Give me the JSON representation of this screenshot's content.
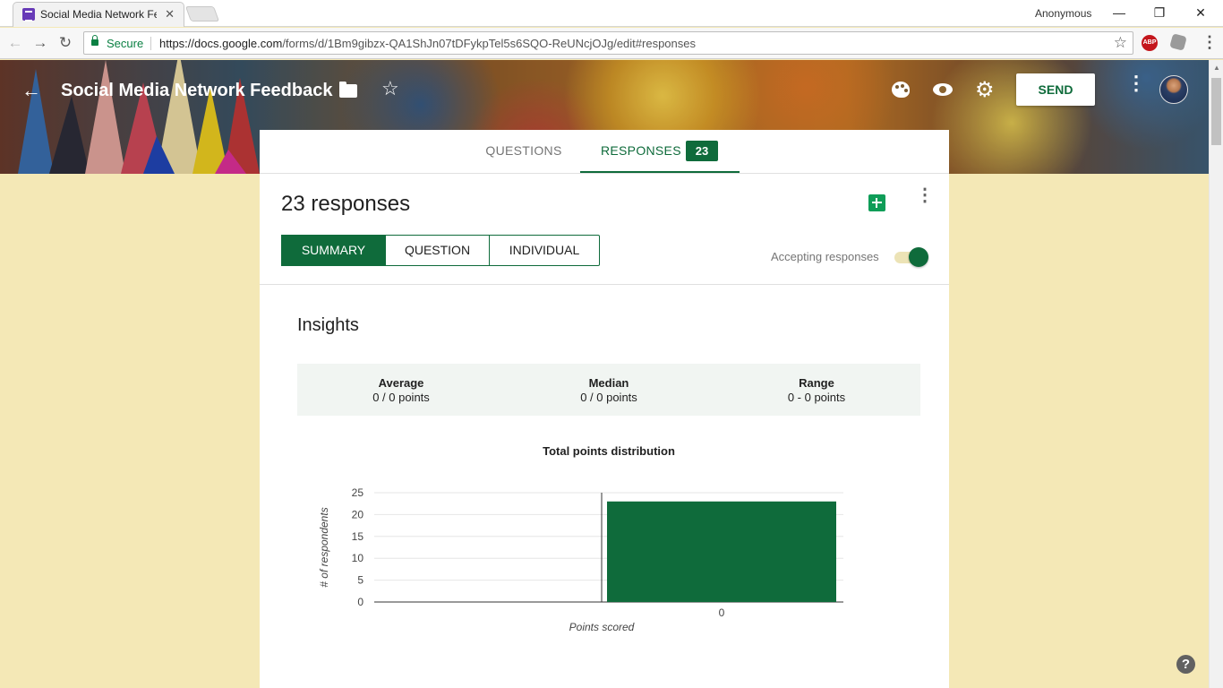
{
  "browser": {
    "tab_title": "Social Media Network Fe",
    "profile": "Anonymous",
    "secure_label": "Secure",
    "url_host": "https://docs.google.com",
    "url_path": "/forms/d/1Bm9gibzx-QA1ShJn07tDFykpTel5s6SQO-ReUNcjOJg/edit#responses",
    "abp_label": "ABP"
  },
  "header": {
    "title": "Social Media Network Feedback",
    "send_label": "SEND"
  },
  "tabs": {
    "questions": "QUESTIONS",
    "responses": "RESPONSES",
    "responses_count": "23"
  },
  "summary": {
    "count_label": "23 responses",
    "views": [
      "SUMMARY",
      "QUESTION",
      "INDIVIDUAL"
    ],
    "active_view": "SUMMARY",
    "accepting_label": "Accepting responses",
    "accepting": true,
    "accent_color": "#0f6b3b"
  },
  "insights": {
    "title": "Insights",
    "stats": [
      {
        "label": "Average",
        "value": "0 / 0 points"
      },
      {
        "label": "Median",
        "value": "0 / 0 points"
      },
      {
        "label": "Range",
        "value": "0 - 0 points"
      }
    ]
  },
  "chart_data": {
    "type": "bar",
    "title": "Total points distribution",
    "xlabel": "Points scored",
    "ylabel": "# of respondents",
    "categories": [
      "0"
    ],
    "values": [
      23
    ],
    "ylim": [
      0,
      25
    ],
    "yticks": [
      0,
      5,
      10,
      15,
      20,
      25
    ],
    "bar_color": "#0f6b3b",
    "grid": true
  },
  "help": "?"
}
